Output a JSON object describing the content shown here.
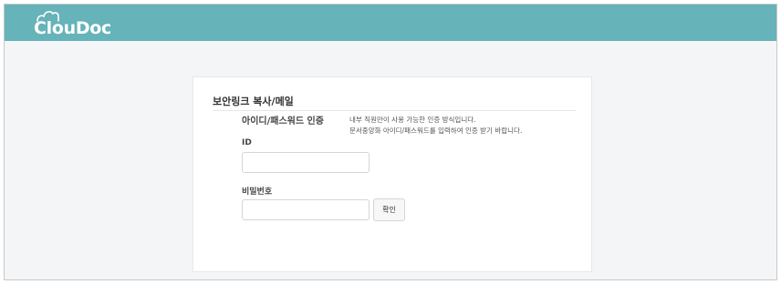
{
  "brand": {
    "logo_text": "ClouDoc",
    "header_color": "#66b3b9"
  },
  "card": {
    "title": "보안링크 복사/메일",
    "auth_title": "아이디/패스워드 인증",
    "description": [
      "내부 직원만이 사용 가능한 인증 방식입니다.",
      "문서중앙화 아이디/패스워드를 입력하여 인증 받기 바랍니다."
    ]
  },
  "form": {
    "id_label": "ID",
    "id_value": "",
    "password_label": "비밀번호",
    "password_value": "",
    "confirm_label": "확인"
  }
}
